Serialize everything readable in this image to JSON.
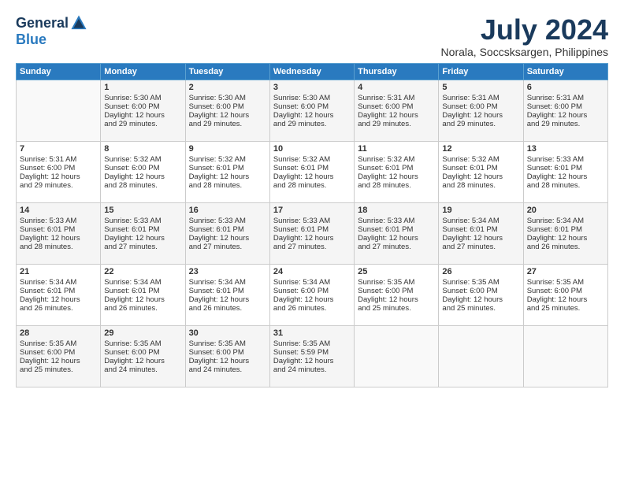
{
  "header": {
    "logo": {
      "general": "General",
      "blue": "Blue"
    },
    "title": "July 2024",
    "location": "Norala, Soccsksargen, Philippines"
  },
  "days_of_week": [
    "Sunday",
    "Monday",
    "Tuesday",
    "Wednesday",
    "Thursday",
    "Friday",
    "Saturday"
  ],
  "weeks": [
    [
      {
        "day": "",
        "info": ""
      },
      {
        "day": "1",
        "info": "Sunrise: 5:30 AM\nSunset: 6:00 PM\nDaylight: 12 hours\nand 29 minutes."
      },
      {
        "day": "2",
        "info": "Sunrise: 5:30 AM\nSunset: 6:00 PM\nDaylight: 12 hours\nand 29 minutes."
      },
      {
        "day": "3",
        "info": "Sunrise: 5:30 AM\nSunset: 6:00 PM\nDaylight: 12 hours\nand 29 minutes."
      },
      {
        "day": "4",
        "info": "Sunrise: 5:31 AM\nSunset: 6:00 PM\nDaylight: 12 hours\nand 29 minutes."
      },
      {
        "day": "5",
        "info": "Sunrise: 5:31 AM\nSunset: 6:00 PM\nDaylight: 12 hours\nand 29 minutes."
      },
      {
        "day": "6",
        "info": "Sunrise: 5:31 AM\nSunset: 6:00 PM\nDaylight: 12 hours\nand 29 minutes."
      }
    ],
    [
      {
        "day": "7",
        "info": "Sunrise: 5:31 AM\nSunset: 6:00 PM\nDaylight: 12 hours\nand 29 minutes."
      },
      {
        "day": "8",
        "info": "Sunrise: 5:32 AM\nSunset: 6:00 PM\nDaylight: 12 hours\nand 28 minutes."
      },
      {
        "day": "9",
        "info": "Sunrise: 5:32 AM\nSunset: 6:01 PM\nDaylight: 12 hours\nand 28 minutes."
      },
      {
        "day": "10",
        "info": "Sunrise: 5:32 AM\nSunset: 6:01 PM\nDaylight: 12 hours\nand 28 minutes."
      },
      {
        "day": "11",
        "info": "Sunrise: 5:32 AM\nSunset: 6:01 PM\nDaylight: 12 hours\nand 28 minutes."
      },
      {
        "day": "12",
        "info": "Sunrise: 5:32 AM\nSunset: 6:01 PM\nDaylight: 12 hours\nand 28 minutes."
      },
      {
        "day": "13",
        "info": "Sunrise: 5:33 AM\nSunset: 6:01 PM\nDaylight: 12 hours\nand 28 minutes."
      }
    ],
    [
      {
        "day": "14",
        "info": "Sunrise: 5:33 AM\nSunset: 6:01 PM\nDaylight: 12 hours\nand 28 minutes."
      },
      {
        "day": "15",
        "info": "Sunrise: 5:33 AM\nSunset: 6:01 PM\nDaylight: 12 hours\nand 27 minutes."
      },
      {
        "day": "16",
        "info": "Sunrise: 5:33 AM\nSunset: 6:01 PM\nDaylight: 12 hours\nand 27 minutes."
      },
      {
        "day": "17",
        "info": "Sunrise: 5:33 AM\nSunset: 6:01 PM\nDaylight: 12 hours\nand 27 minutes."
      },
      {
        "day": "18",
        "info": "Sunrise: 5:33 AM\nSunset: 6:01 PM\nDaylight: 12 hours\nand 27 minutes."
      },
      {
        "day": "19",
        "info": "Sunrise: 5:34 AM\nSunset: 6:01 PM\nDaylight: 12 hours\nand 27 minutes."
      },
      {
        "day": "20",
        "info": "Sunrise: 5:34 AM\nSunset: 6:01 PM\nDaylight: 12 hours\nand 26 minutes."
      }
    ],
    [
      {
        "day": "21",
        "info": "Sunrise: 5:34 AM\nSunset: 6:01 PM\nDaylight: 12 hours\nand 26 minutes."
      },
      {
        "day": "22",
        "info": "Sunrise: 5:34 AM\nSunset: 6:01 PM\nDaylight: 12 hours\nand 26 minutes."
      },
      {
        "day": "23",
        "info": "Sunrise: 5:34 AM\nSunset: 6:01 PM\nDaylight: 12 hours\nand 26 minutes."
      },
      {
        "day": "24",
        "info": "Sunrise: 5:34 AM\nSunset: 6:00 PM\nDaylight: 12 hours\nand 26 minutes."
      },
      {
        "day": "25",
        "info": "Sunrise: 5:35 AM\nSunset: 6:00 PM\nDaylight: 12 hours\nand 25 minutes."
      },
      {
        "day": "26",
        "info": "Sunrise: 5:35 AM\nSunset: 6:00 PM\nDaylight: 12 hours\nand 25 minutes."
      },
      {
        "day": "27",
        "info": "Sunrise: 5:35 AM\nSunset: 6:00 PM\nDaylight: 12 hours\nand 25 minutes."
      }
    ],
    [
      {
        "day": "28",
        "info": "Sunrise: 5:35 AM\nSunset: 6:00 PM\nDaylight: 12 hours\nand 25 minutes."
      },
      {
        "day": "29",
        "info": "Sunrise: 5:35 AM\nSunset: 6:00 PM\nDaylight: 12 hours\nand 24 minutes."
      },
      {
        "day": "30",
        "info": "Sunrise: 5:35 AM\nSunset: 6:00 PM\nDaylight: 12 hours\nand 24 minutes."
      },
      {
        "day": "31",
        "info": "Sunrise: 5:35 AM\nSunset: 5:59 PM\nDaylight: 12 hours\nand 24 minutes."
      },
      {
        "day": "",
        "info": ""
      },
      {
        "day": "",
        "info": ""
      },
      {
        "day": "",
        "info": ""
      }
    ]
  ]
}
